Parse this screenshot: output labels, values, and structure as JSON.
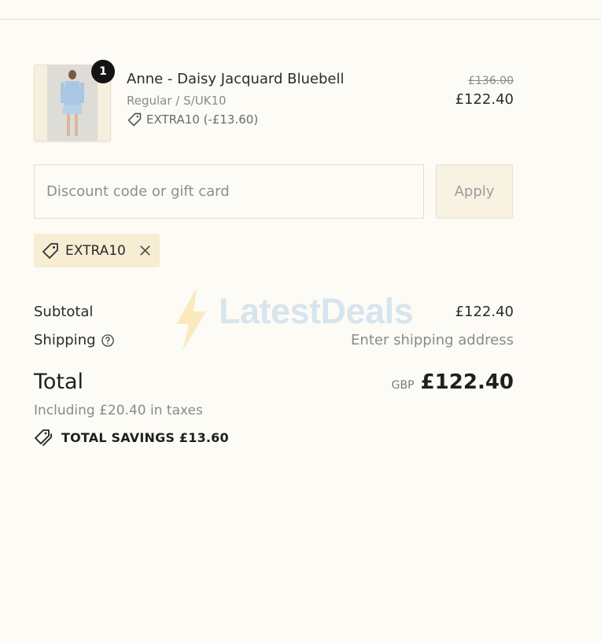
{
  "product": {
    "quantity": "1",
    "name": "Anne - Daisy Jacquard Bluebell",
    "variant": "Regular / S/UK10",
    "discount_label": "EXTRA10 (-£13.60)",
    "price_original": "£136.00",
    "price_current": "£122.40"
  },
  "discount_form": {
    "placeholder": "Discount code or gift card",
    "value": "",
    "apply_label": "Apply"
  },
  "applied_discount": {
    "code": "EXTRA10"
  },
  "summary": {
    "subtotal_label": "Subtotal",
    "subtotal_value": "£122.40",
    "shipping_label": "Shipping",
    "shipping_value": "Enter shipping address",
    "total_label": "Total",
    "total_currency": "GBP",
    "total_value": "£122.40",
    "taxes_note": "Including £20.40 in taxes",
    "savings_text": "TOTAL SAVINGS £13.60"
  },
  "watermark": {
    "text": "LatestDeals"
  },
  "icons": {
    "tag": "tag-icon",
    "close": "close-icon",
    "help": "question-circle-icon",
    "savings": "double-tag-icon"
  },
  "colors": {
    "background": "#fdfbf5",
    "tag_background": "#f6edd3",
    "apply_background": "#f7f2e2",
    "badge": "#141414"
  }
}
